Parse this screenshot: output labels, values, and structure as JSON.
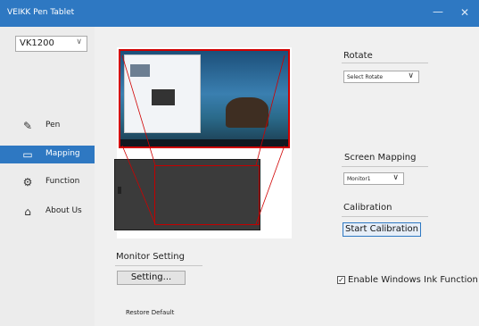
{
  "window": {
    "title": "VEIKK Pen Tablet",
    "minimize_glyph": "—",
    "close_glyph": "✕"
  },
  "sidebar": {
    "model_select": {
      "value": "VK1200",
      "chevron": "∨"
    },
    "items": [
      {
        "label": "Pen",
        "icon": "pen-icon",
        "glyph": "✎",
        "active": false
      },
      {
        "label": "Mapping",
        "icon": "monitor-icon",
        "glyph": "▭",
        "active": true
      },
      {
        "label": "Function",
        "icon": "gear-icon",
        "glyph": "⚙",
        "active": false
      },
      {
        "label": "About Us",
        "icon": "home-icon",
        "glyph": "⌂",
        "active": false
      }
    ]
  },
  "rotate": {
    "label": "Rotate",
    "dropdown_value": "Select Rotate",
    "chevron": "∨"
  },
  "screen_mapping": {
    "label": "Screen Mapping",
    "dropdown_value": "Monitor1",
    "chevron": "∨"
  },
  "calibration": {
    "label": "Calibration",
    "button_label": "Start Calibration"
  },
  "monitor_setting": {
    "label": "Monitor Setting",
    "button_label": "Setting..."
  },
  "restore_default": "Restore Default",
  "windows_ink": {
    "label": "Enable Windows Ink Function",
    "checked": true,
    "check_glyph": "✓"
  },
  "colors": {
    "title_bar": "#2e78c2",
    "active_nav": "#2e78c2",
    "mapping_outline": "#d00000"
  }
}
